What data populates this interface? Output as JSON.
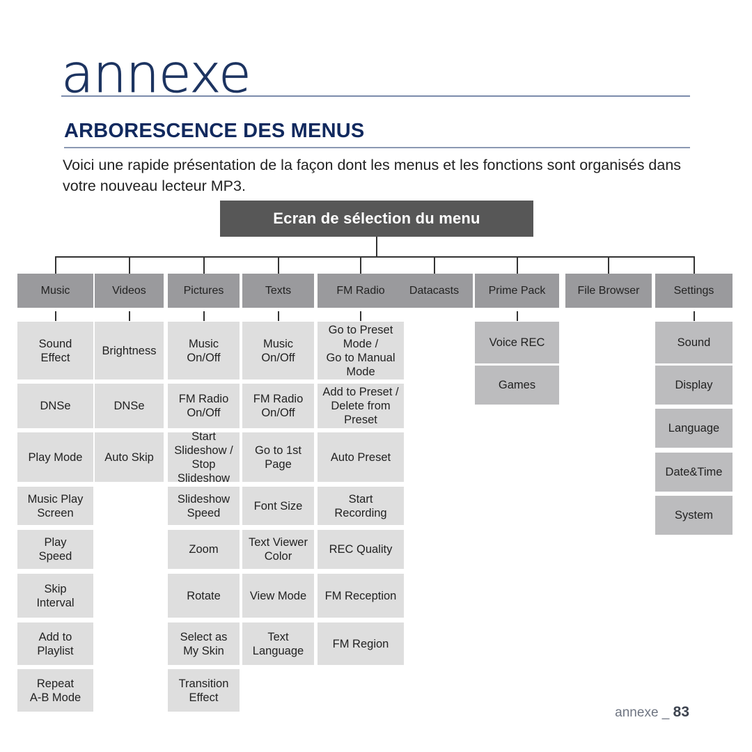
{
  "header": {
    "chapter_title": "annexe",
    "section_title": "ARBORESCENCE DES MENUS",
    "intro": "Voici une rapide présentation de la façon dont les menus et les fonctions sont organisés dans votre nouveau lecteur MP3."
  },
  "root": {
    "label": "Ecran de sélection du menu"
  },
  "colors": {
    "banner_bg": "#575757",
    "top_node_bg": "#9a9a9d",
    "sub_light_bg": "#dedede",
    "sub_dark_bg": "#bcbcbe",
    "title_navy": "#1d3461",
    "section_navy": "#11295e",
    "connector": "#333333"
  },
  "columns": [
    {
      "top": "Music",
      "style": "light",
      "items": [
        "Sound\nEffect",
        "DNSe",
        "Play Mode",
        "Music Play\nScreen",
        "Play\nSpeed",
        "Skip\nInterval",
        "Add to\nPlaylist",
        "Repeat\nA-B Mode"
      ]
    },
    {
      "top": "Videos",
      "style": "light",
      "items": [
        "Brightness",
        "DNSe",
        "Auto Skip"
      ]
    },
    {
      "top": "Pictures",
      "style": "light",
      "items": [
        "Music\nOn/Off",
        "FM Radio\nOn/Off",
        "Start\nSlideshow /\nStop\nSlideshow",
        "Slideshow\nSpeed",
        "Zoom",
        "Rotate",
        "Select as\nMy Skin",
        "Transition\nEffect"
      ]
    },
    {
      "top": "Texts",
      "style": "light",
      "items": [
        "Music\nOn/Off",
        "FM Radio\nOn/Off",
        "Go to 1st\nPage",
        "Font Size",
        "Text Viewer\nColor",
        "View Mode",
        "Text\nLanguage"
      ]
    },
    {
      "top": "FM Radio",
      "style": "light",
      "items": [
        "Go to Preset\nMode /\nGo to Manual\nMode",
        "Add to Preset /\nDelete from\nPreset",
        "Auto Preset",
        "Start\nRecording",
        "REC Quality",
        "FM Reception",
        "FM Region"
      ]
    },
    {
      "top": "Datacasts",
      "style": "light",
      "items": []
    },
    {
      "top": "Prime Pack",
      "style": "dark",
      "items": [
        "Voice REC",
        "Games"
      ]
    },
    {
      "top": "File Browser",
      "style": "light",
      "items": []
    },
    {
      "top": "Settings",
      "style": "dark",
      "items": [
        "Sound",
        "Display",
        "Language",
        "Date&Time",
        "System"
      ]
    }
  ],
  "footer": {
    "label": "annexe _",
    "page": "83"
  }
}
